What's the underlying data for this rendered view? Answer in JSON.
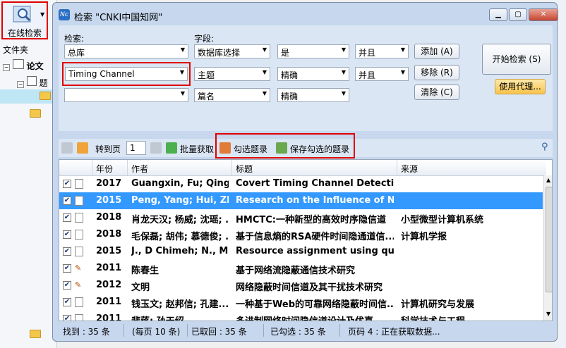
{
  "app": {
    "online_search": "在线检索",
    "folder": "文件夹",
    "tree_root": "论文",
    "tree_child": "题"
  },
  "window": {
    "title": "检索 \"CNKI中国知网\"",
    "icon_text": "Nc"
  },
  "search": {
    "label_search": "检索:",
    "label_field": "字段:",
    "rows": [
      {
        "db": "总库",
        "field": "数据库选择",
        "match": "是",
        "logic": "并且"
      },
      {
        "db": "Timing Channel",
        "field": "主题",
        "match": "精确",
        "logic": "并且"
      },
      {
        "db": "",
        "field": "篇名",
        "match": "精确",
        "logic": ""
      }
    ],
    "add": "添加 (A)",
    "remove": "移除 (R)",
    "clear": "清除 (C)",
    "start": "开始检索 (S)",
    "proxy": "使用代理..."
  },
  "toolbar": {
    "goto": "转到页",
    "page": "1",
    "batch": "批量获取",
    "checked": "勾选题录",
    "save": "保存勾选的题录"
  },
  "table": {
    "headers": [
      "年份",
      "作者",
      "标题",
      "来源"
    ],
    "rows": [
      {
        "year": "2017",
        "author": "Guangxin, Fu; Qing...",
        "title": "Covert Timing Channel Detection",
        "source": "",
        "type": "doc"
      },
      {
        "year": "2015",
        "author": "Peng, Yang; Hui, Zh...",
        "title": "Research on the Influence of Netw",
        "source": "",
        "type": "doc"
      },
      {
        "year": "2018",
        "author": "肖龙天汉; 杨威; 沈瑶; ...",
        "title": "HMCTC:一种新型的高效时序隐信道",
        "source": "小型微型计算机系统",
        "type": "doc"
      },
      {
        "year": "2018",
        "author": "毛保磊; 胡伟; 慕德俊; ...",
        "title": "基于信息熵的RSA硬件时间隐通道信...",
        "source": "计算机学报",
        "type": "doc"
      },
      {
        "year": "2015",
        "author": "J., D Chimeh; N., Mo",
        "title": "Resource assignment using quanti",
        "source": "",
        "type": "doc"
      },
      {
        "year": "2011",
        "author": "陈春生",
        "title": "基于网络流隐蔽通信技术研究",
        "source": "",
        "type": "pdf"
      },
      {
        "year": "2012",
        "author": "文明",
        "title": "网络隐蔽时间信道及其干扰技术研究",
        "source": "",
        "type": "pdf"
      },
      {
        "year": "2011",
        "author": "钱玉文; 赵邦信; 孔建...",
        "title": "一种基于Web的可靠网络隐蔽时间信...",
        "source": "计算机研究与发展",
        "type": "doc"
      },
      {
        "year": "2011",
        "author": "裴蒋; 孙天绍",
        "title": "多进制网络时间隐信道设计及优喜",
        "source": "科学技术与工程",
        "type": "doc"
      }
    ]
  },
  "status": {
    "found": "找到 : 35 条",
    "per_page": "(每页 10 条)",
    "fetched": "已取回 : 35 条",
    "selected": "已勾选 : 35 条",
    "page_info": "页码 4 : 正在获取数据..."
  }
}
